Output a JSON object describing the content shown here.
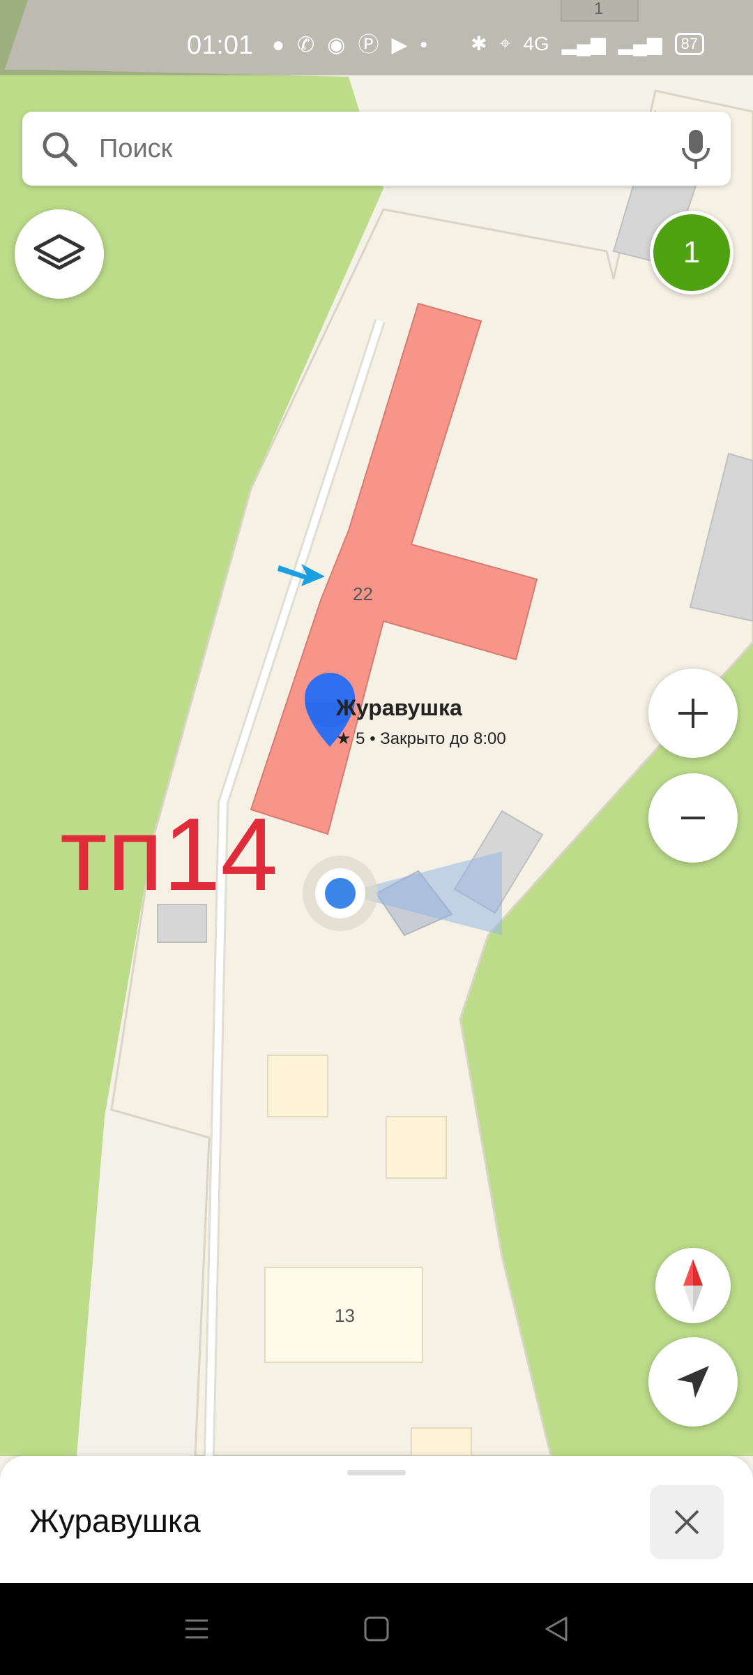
{
  "status_bar": {
    "time": "01:01",
    "network": "4G",
    "battery": "87"
  },
  "search": {
    "placeholder": "Поиск"
  },
  "counter_badge": "1",
  "map": {
    "building_numbers": [
      "22",
      "13",
      "1"
    ],
    "poi": {
      "name": "Журавушка",
      "rating_status": "★ 5 • Закрыто до 8:00"
    },
    "handwritten_label": "тп14"
  },
  "bottom_sheet": {
    "title": "Журавушка"
  },
  "colors": {
    "green_area": "#bcdc8a",
    "ground": "#f4f1e8",
    "building_selected": "#f7958b",
    "building_gray": "#d6d6d6",
    "annotation_red": "#e02b3a",
    "pin_blue": "#2f6ff0"
  }
}
